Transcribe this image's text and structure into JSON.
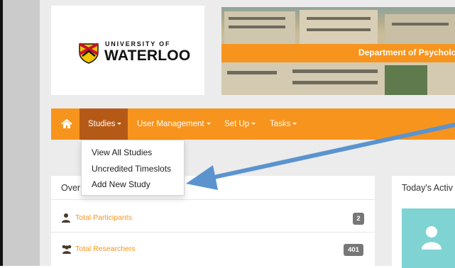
{
  "logo": {
    "line1": "UNIVERSITY OF",
    "line2": "WATERLOO",
    "crest_icon": "university-crest-icon"
  },
  "banner": {
    "title": "Department of Psycholo"
  },
  "nav": {
    "home_icon": "home-icon",
    "items": [
      {
        "label": "Studies"
      },
      {
        "label": "User Management"
      },
      {
        "label": "Set Up"
      },
      {
        "label": "Tasks"
      }
    ]
  },
  "dropdown": {
    "items": [
      {
        "label": "View All Studies"
      },
      {
        "label": "Uncredited Timeslots"
      },
      {
        "label": "Add New Study"
      }
    ]
  },
  "overview": {
    "title": "Over",
    "rows": [
      {
        "label": "Total Participants",
        "count": "2",
        "icon": "user-icon"
      },
      {
        "label": "Total Researchers",
        "count": "401",
        "icon": "users-icon"
      }
    ]
  },
  "activity": {
    "title": "Today's Activ",
    "tile_icon": "user-icon"
  },
  "colors": {
    "brand_orange": "#f7941d",
    "active_nav": "#b55a16",
    "badge": "#777777",
    "tile": "#7fd3d3",
    "annotation_arrow": "#5b93cf"
  }
}
